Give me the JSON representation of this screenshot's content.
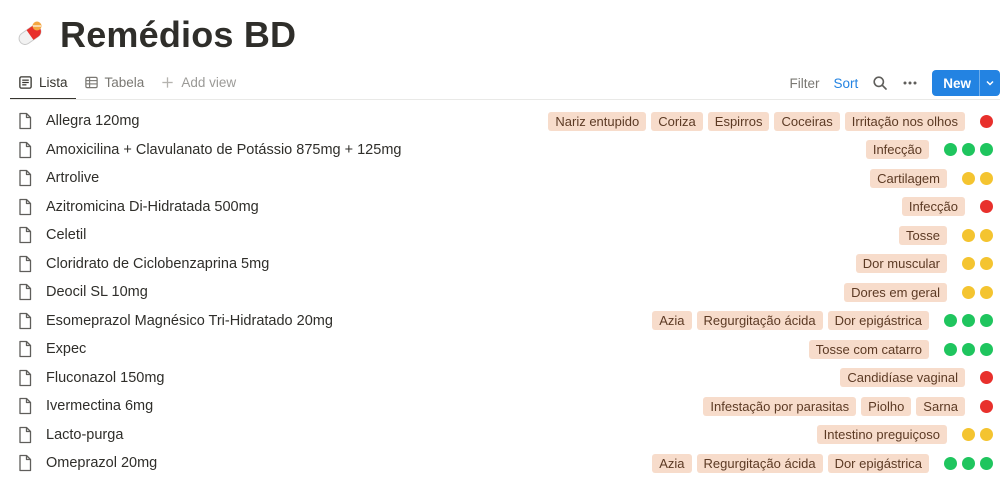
{
  "page": {
    "title": "Remédios BD",
    "icon": "pill-icon"
  },
  "views": {
    "tabs": [
      {
        "label": "Lista",
        "icon": "list-icon",
        "active": true
      },
      {
        "label": "Tabela",
        "icon": "table-icon",
        "active": false
      }
    ],
    "add_view": "Add view"
  },
  "toolbar": {
    "filter": "Filter",
    "sort": "Sort",
    "new": "New"
  },
  "colors": {
    "accent": "#2383e2",
    "tag_bg": "#f7dccb",
    "green": "#1fc55e",
    "yellow": "#f4c430",
    "red": "#e8302c"
  },
  "rows": [
    {
      "name": "Allegra 120mg",
      "tags": [
        "Nariz entupido",
        "Coriza",
        "Espirros",
        "Coceiras",
        "Irritação nos olhos"
      ],
      "dots": [
        "red"
      ]
    },
    {
      "name": "Amoxicilina + Clavulanato de Potássio 875mg + 125mg",
      "tags": [
        "Infecção"
      ],
      "dots": [
        "green",
        "green",
        "green"
      ]
    },
    {
      "name": "Artrolive",
      "tags": [
        "Cartilagem"
      ],
      "dots": [
        "yellow",
        "yellow"
      ]
    },
    {
      "name": "Azitromicina Di-Hidratada 500mg",
      "tags": [
        "Infecção"
      ],
      "dots": [
        "red"
      ]
    },
    {
      "name": "Celetil",
      "tags": [
        "Tosse"
      ],
      "dots": [
        "yellow",
        "yellow"
      ]
    },
    {
      "name": "Cloridrato de Ciclobenzaprina 5mg",
      "tags": [
        "Dor muscular"
      ],
      "dots": [
        "yellow",
        "yellow"
      ]
    },
    {
      "name": "Deocil SL 10mg",
      "tags": [
        "Dores em geral"
      ],
      "dots": [
        "yellow",
        "yellow"
      ]
    },
    {
      "name": "Esomeprazol Magnésico Tri-Hidratado 20mg",
      "tags": [
        "Azia",
        "Regurgitação ácida",
        "Dor epigástrica"
      ],
      "dots": [
        "green",
        "green",
        "green"
      ]
    },
    {
      "name": "Expec",
      "tags": [
        "Tosse com catarro"
      ],
      "dots": [
        "green",
        "green",
        "green"
      ]
    },
    {
      "name": "Fluconazol 150mg",
      "tags": [
        "Candidíase vaginal"
      ],
      "dots": [
        "red"
      ]
    },
    {
      "name": "Ivermectina 6mg",
      "tags": [
        "Infestação por parasitas",
        "Piolho",
        "Sarna"
      ],
      "dots": [
        "red"
      ]
    },
    {
      "name": "Lacto-purga",
      "tags": [
        "Intestino preguiçoso"
      ],
      "dots": [
        "yellow",
        "yellow"
      ]
    },
    {
      "name": "Omeprazol 20mg",
      "tags": [
        "Azia",
        "Regurgitação ácida",
        "Dor epigástrica"
      ],
      "dots": [
        "green",
        "green",
        "green"
      ]
    }
  ]
}
